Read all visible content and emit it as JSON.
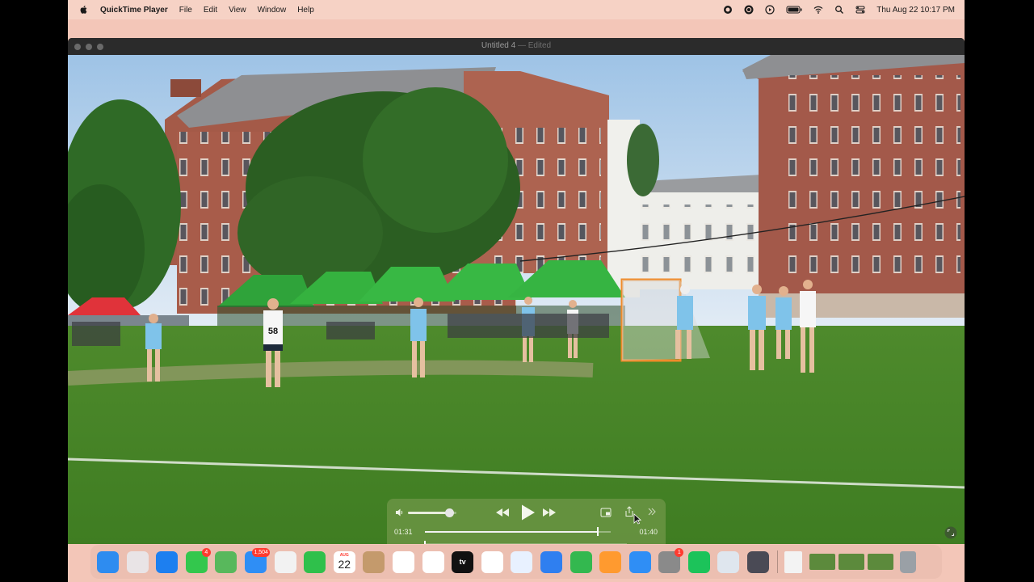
{
  "menubar": {
    "app_name": "QuickTime Player",
    "menus": [
      "File",
      "Edit",
      "View",
      "Window",
      "Help"
    ],
    "datetime": "Thu Aug 22  10:17 PM",
    "status_icons": [
      "record-icon",
      "chatgpt-icon",
      "play-circle-icon",
      "battery-icon",
      "wifi-icon",
      "search-icon",
      "control-center-icon"
    ]
  },
  "window": {
    "title": "Untitled 4",
    "title_suffix": "— Edited"
  },
  "video": {
    "jersey_number": "58"
  },
  "player": {
    "current_time": "01:31",
    "end_time": "01:40",
    "volume_fraction": 0.85,
    "progress_fraction": 0.93,
    "icons": [
      "volume-icon",
      "rewind-icon",
      "play-icon",
      "fast-forward-icon",
      "picture-in-picture-icon",
      "share-icon",
      "more-icon"
    ]
  },
  "dock": {
    "apps": [
      {
        "name": "finder",
        "color": "#2e8cf0"
      },
      {
        "name": "launchpad",
        "color": "#e9e4e6"
      },
      {
        "name": "safari",
        "color": "#1d7ff0"
      },
      {
        "name": "messages",
        "color": "#33c74d",
        "badge": "4"
      },
      {
        "name": "maps",
        "color": "#58b85c"
      },
      {
        "name": "mail",
        "color": "#2f8ef5",
        "badge": "1,504"
      },
      {
        "name": "photos",
        "color": "#f2f2f2"
      },
      {
        "name": "facetime",
        "color": "#2fc04b"
      },
      {
        "name": "calendar",
        "color": "#ffffff",
        "month": "AUG",
        "day": "22"
      },
      {
        "name": "keynote-folder",
        "color": "#c49a6c"
      },
      {
        "name": "reminders",
        "color": "#ffffff"
      },
      {
        "name": "notes",
        "color": "#ffffff"
      },
      {
        "name": "apple-tv",
        "color": "#111111",
        "label": "tv"
      },
      {
        "name": "news",
        "color": "#ffffff"
      },
      {
        "name": "freeform",
        "color": "#e8f1ff"
      },
      {
        "name": "keynote",
        "color": "#2f7ff0"
      },
      {
        "name": "numbers",
        "color": "#33b84f"
      },
      {
        "name": "pages",
        "color": "#ff9a2f"
      },
      {
        "name": "app-store",
        "color": "#2f8ef5"
      },
      {
        "name": "system-settings",
        "color": "#8a8a8a",
        "badge": "1"
      },
      {
        "name": "spotify",
        "color": "#1cc35a"
      },
      {
        "name": "preview",
        "color": "#dfe6ee"
      },
      {
        "name": "quicktime",
        "color": "#4a4a55"
      }
    ],
    "others": [
      {
        "name": "document-thumbnail",
        "color": "#f3f3f3"
      },
      {
        "name": "video-thumbnail-1",
        "color": "#5c8a3c"
      },
      {
        "name": "video-thumbnail-2",
        "color": "#5c8a3c"
      },
      {
        "name": "video-thumbnail-3",
        "color": "#5c8a3c"
      },
      {
        "name": "trash",
        "color": "#9aa0a6"
      }
    ]
  }
}
